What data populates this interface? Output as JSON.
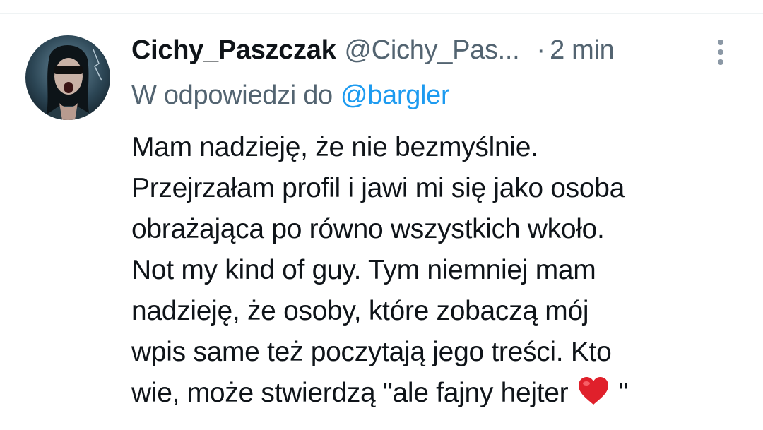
{
  "tweet": {
    "author": {
      "display_name": "Cichy_Paszczak",
      "handle": "@Cichy_Pas...",
      "avatar_icon": "avatar-photo"
    },
    "separator": "·",
    "time": "2 min",
    "reply": {
      "prefix": "W odpowiedzi do",
      "mention": "@bargler"
    },
    "body_lines": [
      "Mam nadzieję, że nie bezmyślnie.",
      "Przejrzałam profil i jawi mi się jako osoba",
      "obrażająca po równo wszystkich wkoło.",
      "Not my kind of guy. Tym niemniej mam",
      "nadzieję, że osoby, które zobaczą mój",
      "wpis same też poczytają jego treści. Kto"
    ],
    "last_line": {
      "before_emoji": "wie, może stwierdzą \"ale fajny hejter ",
      "emoji": "red-heart-icon",
      "after_emoji": "\""
    }
  },
  "icons": {
    "more": "vertical-ellipsis-icon"
  },
  "colors": {
    "text": "#0f1419",
    "secondary": "#536471",
    "link": "#1d9bf0",
    "heart": "#e0202b",
    "divider": "#eff3f4",
    "more_icon": "#8b98a5"
  }
}
